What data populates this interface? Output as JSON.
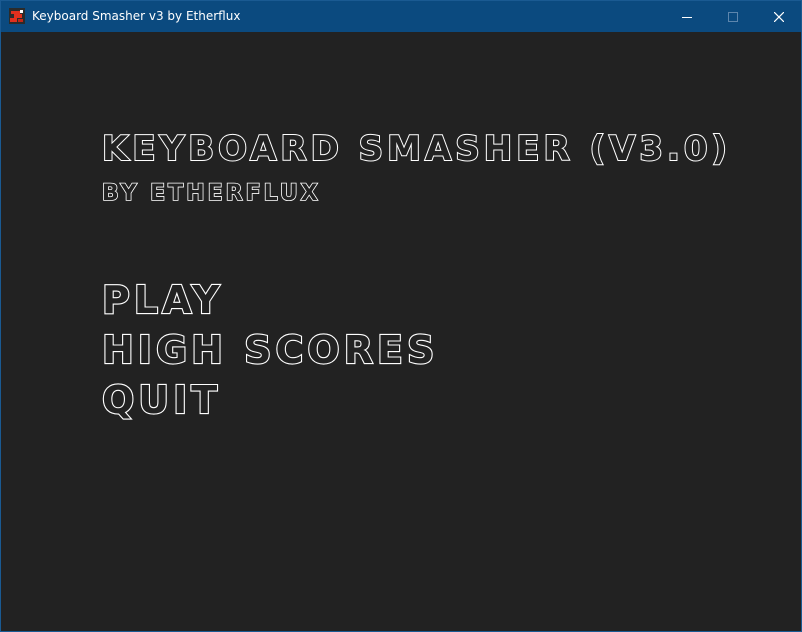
{
  "window": {
    "title": "Keyboard Smasher v3 by Etherflux",
    "app_icon": "game-app-icon",
    "controls": {
      "minimize_icon": "minimize-icon",
      "maximize_icon": "maximize-icon",
      "close_icon": "close-icon"
    }
  },
  "game": {
    "title": "Keyboard Smasher (v3.0)",
    "subtitle": "By Etherflux",
    "menu": {
      "play": "Play",
      "high_scores": "High Scores",
      "quit": "Quit"
    }
  },
  "colors": {
    "titlebar": "#0b4a7f",
    "background": "#222222",
    "text_outline": "#ffffff"
  }
}
